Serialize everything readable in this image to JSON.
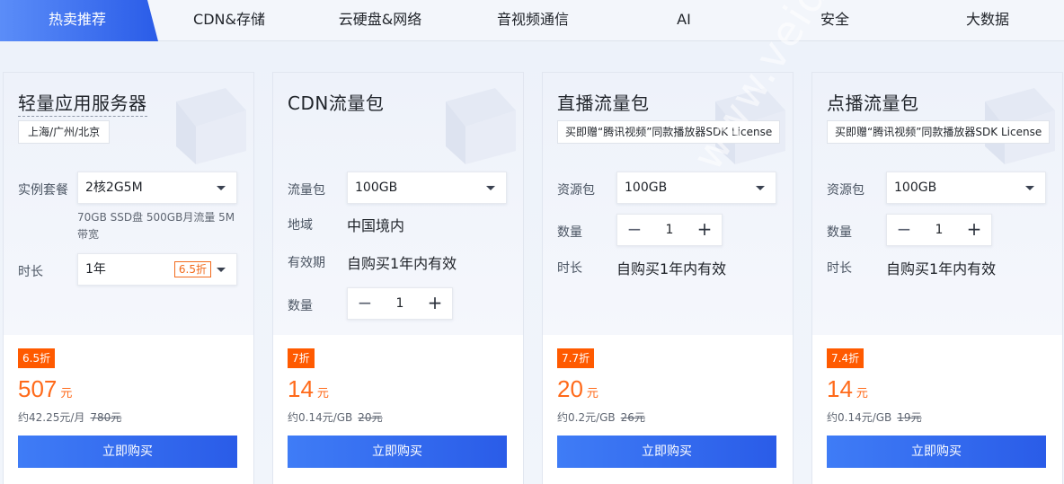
{
  "tabs": [
    {
      "label": "热卖推荐",
      "active": true
    },
    {
      "label": "CDN&存储",
      "active": false
    },
    {
      "label": "云硬盘&网络",
      "active": false
    },
    {
      "label": "音视频通信",
      "active": false
    },
    {
      "label": "AI",
      "active": false
    },
    {
      "label": "安全",
      "active": false
    },
    {
      "label": "大数据",
      "active": false
    }
  ],
  "colors": {
    "accent": "#2a5ce8",
    "price": "#ff6a1a",
    "badge": "#ff5a00"
  },
  "watermark": "www.veidc.com",
  "cards": [
    {
      "title": "轻量应用服务器",
      "tag": "上海/广州/北京",
      "spec_label": "实例套餐",
      "spec_value": "2核2G5M",
      "spec_note": "70GB SSD盘 500GB月流量 5M带宽",
      "duration_label": "时长",
      "duration_value": "1年",
      "duration_discount": "6.5折",
      "discount": "6.5折",
      "price": "507",
      "price_unit": "元",
      "price_sub": "约42.25元/月",
      "orig_price": "780元",
      "buy_label": "立即购买"
    },
    {
      "title": "CDN流量包",
      "pkg_label": "流量包",
      "pkg_value": "100GB",
      "region_label": "地域",
      "region_value": "中国境内",
      "validity_label": "有效期",
      "validity_value": "自购买1年内有效",
      "qty_label": "数量",
      "qty_value": "1",
      "discount": "7折",
      "price": "14",
      "price_unit": "元",
      "price_sub": "约0.14元/GB",
      "orig_price": "20元",
      "buy_label": "立即购买"
    },
    {
      "title": "直播流量包",
      "tag": "买即赠“腾讯视频”同款播放器SDK License",
      "pkg_label": "资源包",
      "pkg_value": "100GB",
      "qty_label": "数量",
      "qty_value": "1",
      "duration_label": "时长",
      "duration_value": "自购买1年内有效",
      "discount": "7.7折",
      "price": "20",
      "price_unit": "元",
      "price_sub": "约0.2元/GB",
      "orig_price": "26元",
      "buy_label": "立即购买"
    },
    {
      "title": "点播流量包",
      "tag": "买即赠“腾讯视频”同款播放器SDK License",
      "pkg_label": "资源包",
      "pkg_value": "100GB",
      "qty_label": "数量",
      "qty_value": "1",
      "duration_label": "时长",
      "duration_value": "自购买1年内有效",
      "discount": "7.4折",
      "price": "14",
      "price_unit": "元",
      "price_sub": "约0.14元/GB",
      "orig_price": "19元",
      "buy_label": "立即购买"
    }
  ]
}
